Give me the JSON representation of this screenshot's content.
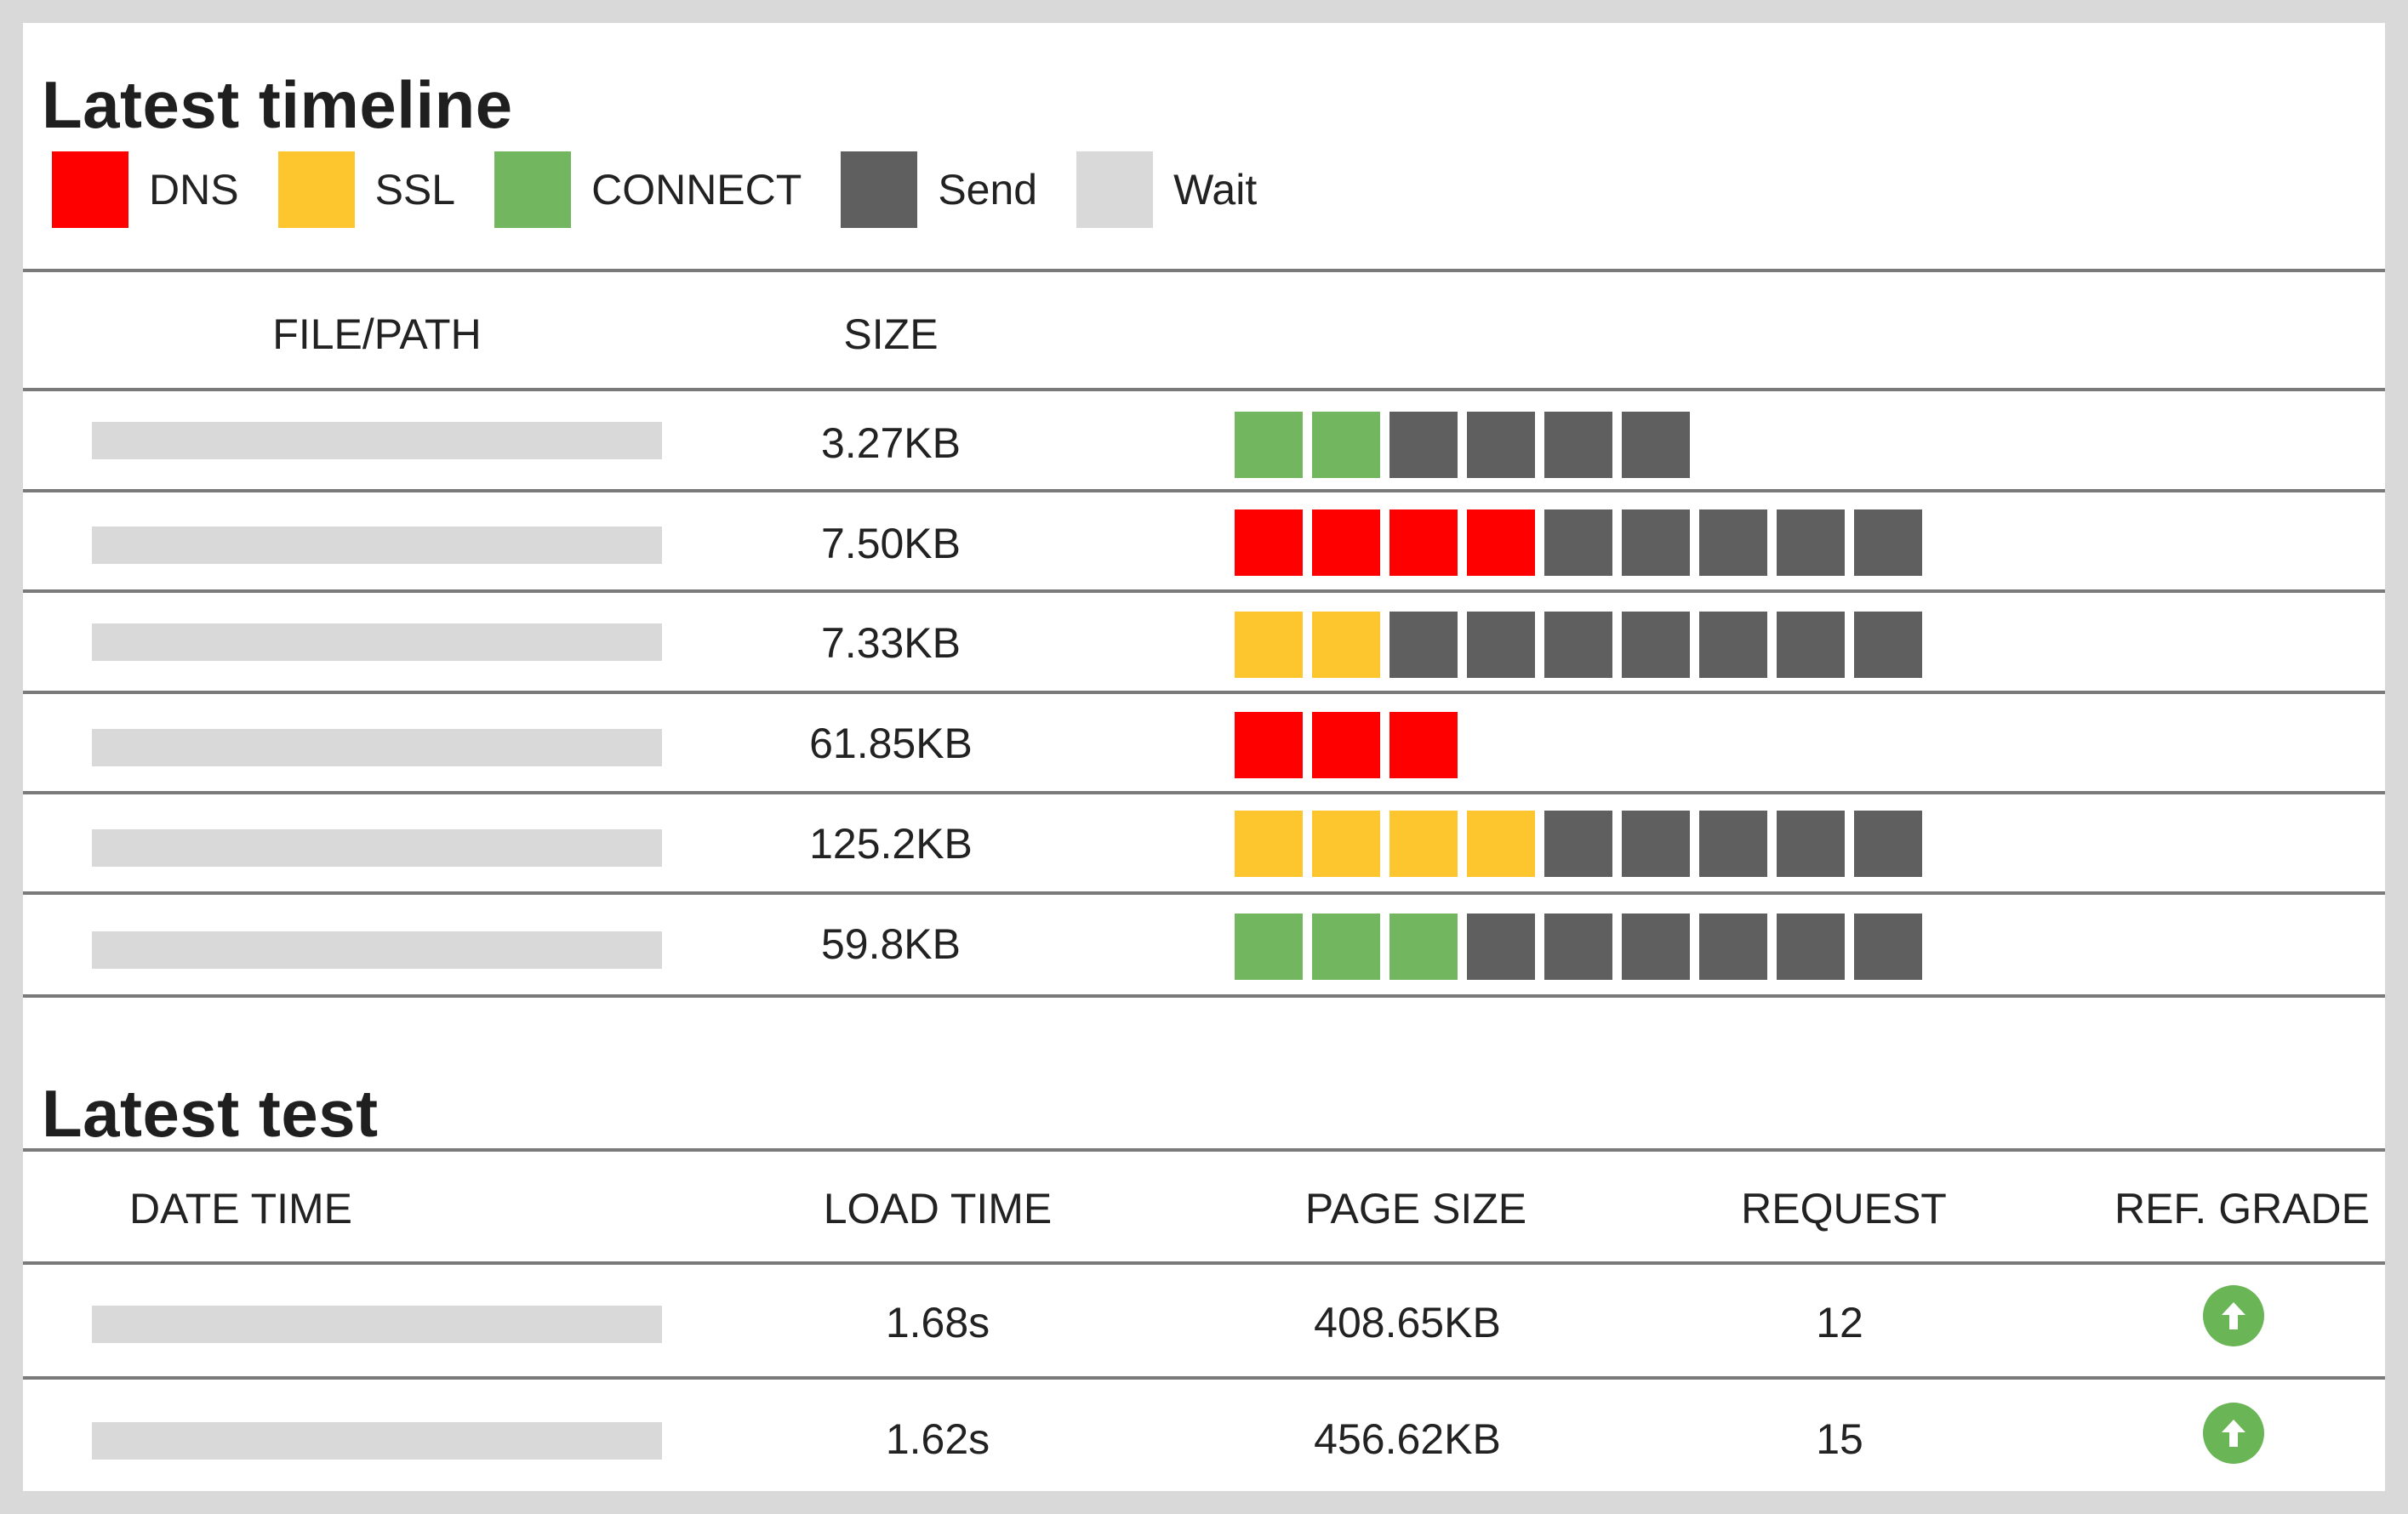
{
  "timeline": {
    "title": "Latest timeline",
    "legend": [
      {
        "label": "DNS",
        "color": "#ff0000"
      },
      {
        "label": "SSL",
        "color": "#fec62e"
      },
      {
        "label": "CONNECT",
        "color": "#72b760"
      },
      {
        "label": "Send",
        "color": "#5f5f5f"
      },
      {
        "label": "Wait",
        "color": "#d9d9d9"
      }
    ],
    "columns": {
      "file": "FILE/PATH",
      "size": "SIZE"
    },
    "rows": [
      {
        "size": "3.27KB",
        "segments": [
          "CONNECT",
          "CONNECT",
          "Send",
          "Send",
          "Send",
          "Send"
        ]
      },
      {
        "size": "7.50KB",
        "segments": [
          "DNS",
          "DNS",
          "DNS",
          "DNS",
          "Send",
          "Send",
          "Send",
          "Send",
          "Send"
        ]
      },
      {
        "size": "7.33KB",
        "segments": [
          "SSL",
          "SSL",
          "Send",
          "Send",
          "Send",
          "Send",
          "Send",
          "Send",
          "Send"
        ]
      },
      {
        "size": "61.85KB",
        "segments": [
          "DNS",
          "DNS",
          "DNS"
        ]
      },
      {
        "size": "125.2KB",
        "segments": [
          "SSL",
          "SSL",
          "SSL",
          "SSL",
          "Send",
          "Send",
          "Send",
          "Send",
          "Send"
        ]
      },
      {
        "size": "59.8KB",
        "segments": [
          "CONNECT",
          "CONNECT",
          "CONNECT",
          "Send",
          "Send",
          "Send",
          "Send",
          "Send",
          "Send"
        ]
      }
    ]
  },
  "test": {
    "title": "Latest test",
    "columns": {
      "date_time": "DATE TIME",
      "load_time": "LOAD TIME",
      "page_size": "PAGE SIZE",
      "request": "REQUEST",
      "grade": "REF. GRADE"
    },
    "rows": [
      {
        "load_time": "1.68s",
        "page_size": "408.65KB",
        "request": "12",
        "grade_icon": "arrow-up-circle-icon"
      },
      {
        "load_time": "1.62s",
        "page_size": "456.62KB",
        "request": "15",
        "grade_icon": "arrow-up-circle-icon"
      }
    ]
  }
}
